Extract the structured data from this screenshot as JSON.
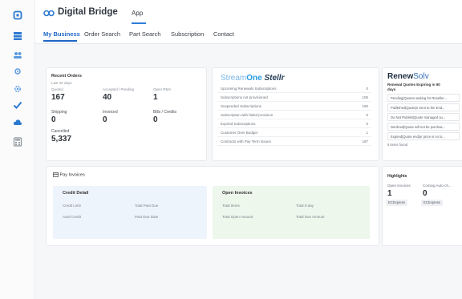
{
  "header": {
    "brand_name": "Digital Bridge",
    "app_tab": "App"
  },
  "tabs": [
    "My Business",
    "Order Search",
    "Part Search",
    "Subscription",
    "Contact"
  ],
  "recent_orders": {
    "title": "Recent Orders",
    "period": "Last 30 days",
    "metrics": [
      {
        "label": "Quoted",
        "value": "167"
      },
      {
        "label": "Accepted / Pending",
        "value": "40"
      },
      {
        "label": "Open RMA",
        "value": "1"
      },
      {
        "label": "Shipping",
        "value": "0"
      },
      {
        "label": "Invoiced",
        "value": "0"
      },
      {
        "label": "Bills / Credits",
        "value": "0"
      },
      {
        "label": "Cancelled",
        "value": "5,337"
      }
    ]
  },
  "streamone": {
    "logo_part1": "Stream",
    "logo_part2": "One",
    "logo_part3": "Stellr",
    "rows": [
      {
        "label": "Upcoming Renewals Subscriptions",
        "value": "0"
      },
      {
        "label": "Subscriptions not provisioned",
        "value": "105"
      },
      {
        "label": "Suspended Subscriptions",
        "value": "150"
      },
      {
        "label": "Subscription with failed provision",
        "value": "0"
      },
      {
        "label": "Expired Subscriptions",
        "value": "0"
      },
      {
        "label": "Customer Over Budget",
        "value": "1"
      },
      {
        "label": "Contracts with Pay Term Issues",
        "value": "187"
      }
    ]
  },
  "renewsolv": {
    "logo_part1": "Renew",
    "logo_part2": "Solv",
    "subtitle_line1": "Renewal Quotes Expiring in 90",
    "subtitle_line2": "days",
    "quotes": [
      "Pending|Quotes waiting for Reseller...",
      "Published|Quote|s Sent to the End...",
      "Do Not Publish|Quote managed ou...",
      "Declined|Quote will not be purchas...",
      "Expired|Quote end|or price is no lo..."
    ],
    "found_text": "5 items found"
  },
  "pay_invoices": {
    "title": "Pay Invoices",
    "credit_detail": {
      "title": "Credit Detail",
      "labels": [
        "Credit Limit",
        "Total Past Due",
        "Avail Credit",
        "Past Due Date"
      ]
    },
    "open_invoices": {
      "title": "Open Invoices",
      "labels": [
        "Total Items",
        "Total 0-day",
        "Total Open Amount",
        "Total Due Amount"
      ]
    }
  },
  "highlights": {
    "title": "Highlights",
    "items": [
      {
        "label": "Open Invoices",
        "value": "1",
        "badge": "ECExpress"
      },
      {
        "label": "Coming Auto-ch...",
        "value": "0",
        "badge": "ECExpress"
      }
    ]
  },
  "colors": {
    "accent": "#1f66c9",
    "credit_panel": "#eef4fb",
    "open_panel": "#edf7ec"
  }
}
